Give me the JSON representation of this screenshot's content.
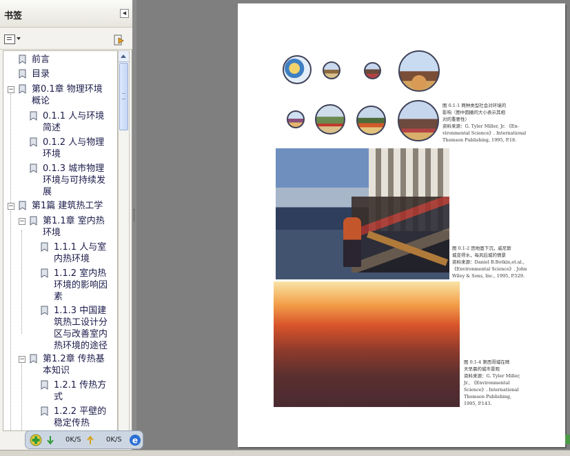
{
  "bookmarks_panel": {
    "title": "书签",
    "items": [
      {
        "label": "前言"
      },
      {
        "label": "目录"
      },
      {
        "label": "第0.1章  物理环境\n概论"
      },
      {
        "label": "0.1.1  人与环境\n简述"
      },
      {
        "label": "0.1.2  人与物理\n环境"
      },
      {
        "label": "0.1.3  城市物理\n环境与可持续发\n展"
      },
      {
        "label": "第1篇  建筑热工学"
      },
      {
        "label": "第1.1章  室内热\n环境"
      },
      {
        "label": "1.1.1  人与室\n内热环境"
      },
      {
        "label": "1.1.2  室内热\n环境的影响因\n素"
      },
      {
        "label": "1.1.3  中国建\n筑热工设计分\n区与改善室内\n热环境的途径"
      },
      {
        "label": "第1.2章  传热基\n本知识"
      },
      {
        "label": "1.2.1  传热方\n式"
      },
      {
        "label": "1.2.2  平壁的\n稳定传热"
      }
    ]
  },
  "document_page": {
    "caption_1": [
      "图 0.1-1  两种类型社会对环境的",
      "影响（图中圆圈的大小表示其相",
      "对的重要性）",
      "资料来源：G. Tyler Miller, Jr. 《En-",
      "vironmental Science》. International",
      "Thomson Publishing, 1995, P.18."
    ],
    "caption_2": [
      "图 0.1-2  因地面下沉，威尼斯",
      "城变得水，每风后城的情景",
      "资料来源：Daniel B.Botkin,et.al.,",
      "《Environmental Science》. John",
      "Wiley & Sons, Inc., 1995, P.529."
    ],
    "caption_3": [
      "图 0.1-4  第西哥城在晴",
      "天早晨的城市景观",
      "资料来源：G. Tyler Miller,",
      "Jr., 《Environmental",
      "Science》. International",
      "Thomson Publishing,",
      "1995, P.143."
    ]
  },
  "download_bar": {
    "down_speed": "0K/S",
    "up_speed": "0K/S"
  },
  "colors": {
    "panel_bg": "#f3f2ee",
    "viewer_bg": "#7f7f7f",
    "accent_green": "#3aa54a",
    "ie_blue": "#2b6fd4"
  }
}
